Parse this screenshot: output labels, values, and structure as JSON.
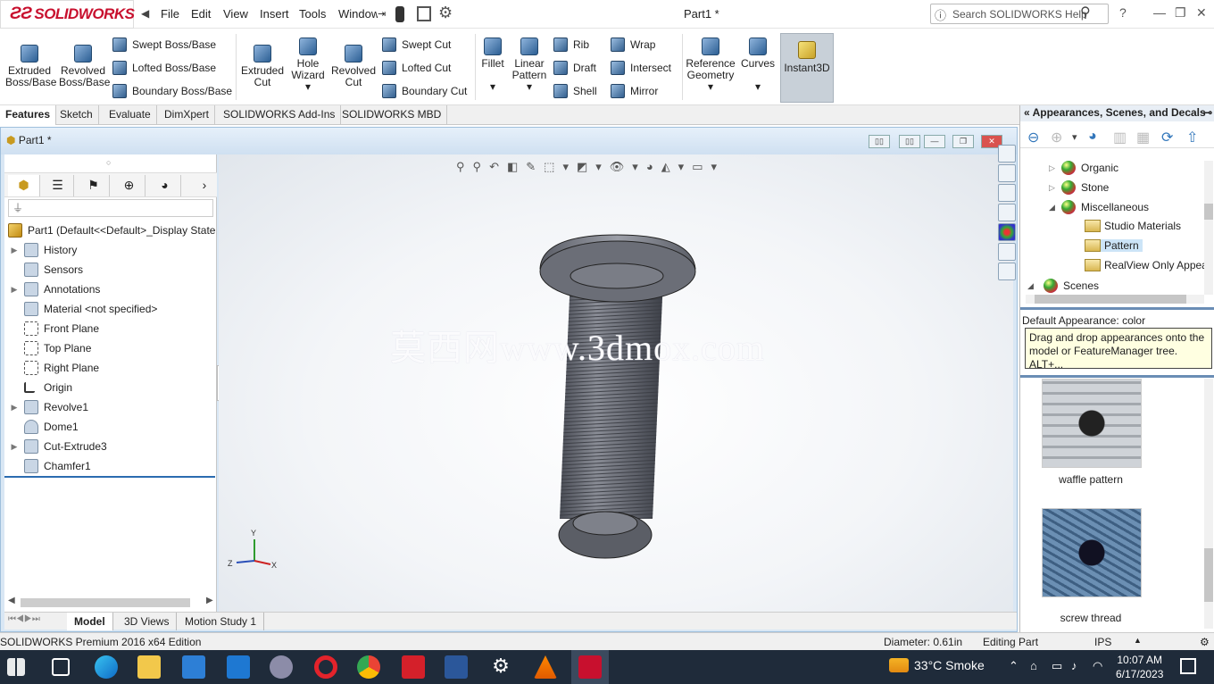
{
  "app": {
    "brand": "SOLIDWORKS",
    "document_title": "Part1 *"
  },
  "menu": [
    "File",
    "Edit",
    "View",
    "Insert",
    "Tools",
    "Window"
  ],
  "search": {
    "placeholder": "Search SOLIDWORKS Help"
  },
  "commands": {
    "extruded_boss": "Extruded Boss/Base",
    "revolved_boss": "Revolved Boss/Base",
    "swept_boss": "Swept Boss/Base",
    "lofted_boss": "Lofted Boss/Base",
    "boundary_boss": "Boundary Boss/Base",
    "extruded_cut": "Extruded Cut",
    "hole_wizard": "Hole Wizard",
    "revolved_cut": "Revolved Cut",
    "swept_cut": "Swept Cut",
    "lofted_cut": "Lofted Cut",
    "boundary_cut": "Boundary Cut",
    "fillet": "Fillet",
    "linear_pattern": "Linear Pattern",
    "rib": "Rib",
    "draft": "Draft",
    "shell": "Shell",
    "wrap": "Wrap",
    "intersect": "Intersect",
    "mirror": "Mirror",
    "reference_geometry": "Reference Geometry",
    "curves": "Curves",
    "instant3d": "Instant3D"
  },
  "tabs": [
    "Features",
    "Sketch",
    "Evaluate",
    "DimXpert",
    "SOLIDWORKS Add-Ins",
    "SOLIDWORKS MBD"
  ],
  "document": {
    "tab": "Part1 *"
  },
  "feature_tree": {
    "filter_placeholder": "",
    "root": "Part1  (Default<<Default>_Display State",
    "items": [
      "History",
      "Sensors",
      "Annotations",
      "Material <not specified>",
      "Front Plane",
      "Top Plane",
      "Right Plane",
      "Origin",
      "Revolve1",
      "Dome1",
      "Cut-Extrude3",
      "Chamfer1"
    ]
  },
  "watermark": "莫西网www.3dmox.com",
  "triad": {
    "z": "Z",
    "x": "X",
    "y": "Y"
  },
  "bottom_tabs": [
    "Model",
    "3D Views",
    "Motion Study 1"
  ],
  "task_pane": {
    "title": "Appearances, Scenes, and Decals",
    "tree": [
      "Organic",
      "Stone",
      "Miscellaneous",
      "Studio Materials",
      "Pattern",
      "RealView Only Appea",
      "Scenes"
    ],
    "default_appearance": "Default Appearance: color",
    "tip": "Drag and drop appearances onto the model or FeatureManager tree.  ALT+...",
    "swatches": [
      "waffle pattern",
      "screw thread"
    ]
  },
  "status": {
    "edition": "SOLIDWORKS Premium 2016 x64 Edition",
    "diameter": "Diameter: 0.61in",
    "mode": "Editing Part",
    "units": "IPS"
  },
  "taskbar": {
    "weather": "33°C  Smoke",
    "time": "10:07 AM",
    "date": "6/17/2023"
  },
  "colors": {
    "brand": "#c8102e",
    "accent": "#3377bb",
    "tip_bg": "#ffffe1",
    "taskbar": "#1f2b3a"
  }
}
